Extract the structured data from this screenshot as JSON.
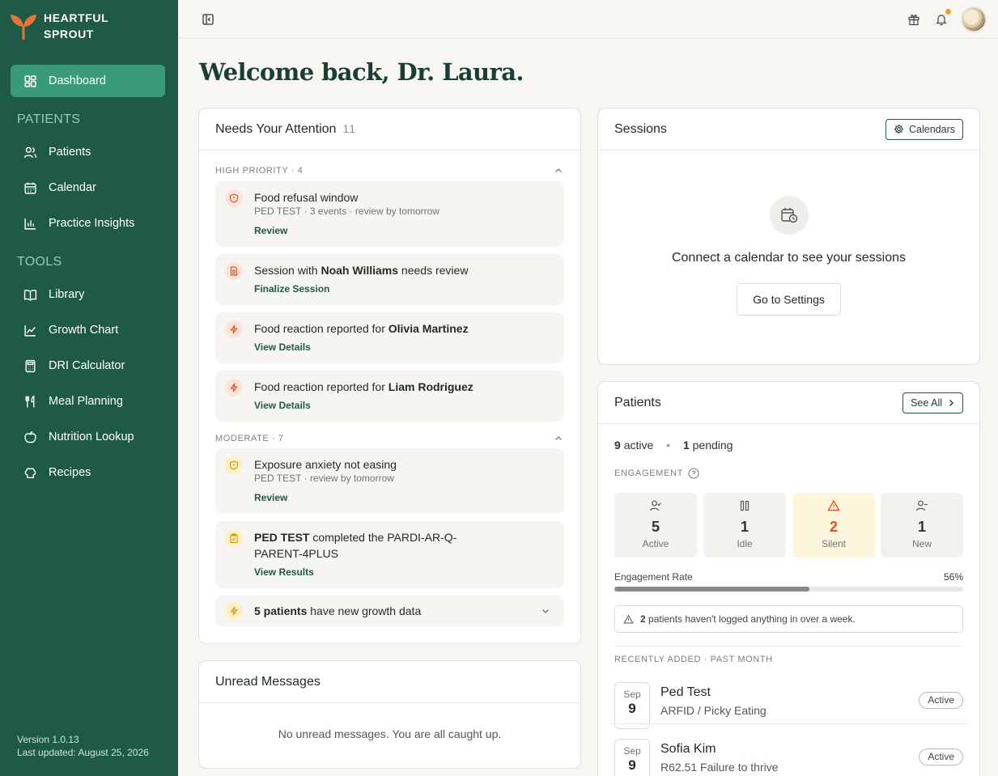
{
  "app": {
    "brand_line1": "HEARTFUL",
    "brand_line2": "SPROUT"
  },
  "sidebar": {
    "dashboard": "Dashboard",
    "patients_section": "PATIENTS",
    "patients_items": [
      "Patients",
      "Calendar",
      "Practice Insights"
    ],
    "tools_section": "TOOLS",
    "tools_items": [
      "Library",
      "Growth Chart",
      "DRI Calculator",
      "Meal Planning",
      "Nutrition Lookup",
      "Recipes"
    ],
    "version": "Version 1.0.13",
    "last_updated": "Last updated: August 25, 2026"
  },
  "header": {
    "welcome": "Welcome back, Dr. Laura."
  },
  "attention": {
    "title": "Needs Your Attention",
    "count": "11",
    "high_label": "HIGH PRIORITY · 4",
    "moderate_label": "MODERATE · 7",
    "items": [
      {
        "title": "Food refusal window",
        "sub": "PED TEST · 3 events · review by tomorrow",
        "link": "Review"
      },
      {
        "pre": "Session with ",
        "bold": "Noah Williams",
        "post": " needs review",
        "link": "Finalize Session"
      },
      {
        "pre": "Food reaction reported for ",
        "bold": "Olivia Martinez",
        "link": "View Details"
      },
      {
        "pre": "Food reaction reported for ",
        "bold": "Liam Rodriguez",
        "link": "View Details"
      },
      {
        "title": "Exposure anxiety not easing",
        "sub": "PED TEST · review by tomorrow",
        "link": "Review"
      },
      {
        "bold": "PED TEST",
        "post": " completed the PARDI-AR-Q-PARENT-4PLUS",
        "link": "View Results"
      },
      {
        "bold": "5 patients",
        "post": " have new growth data"
      }
    ]
  },
  "sessions": {
    "title": "Sessions",
    "calendars_button": "Calendars",
    "empty_text": "Connect a calendar to see your sessions",
    "settings_button": "Go to Settings"
  },
  "messages": {
    "title": "Unread Messages",
    "empty_text": "No unread messages. You are all caught up."
  },
  "patients": {
    "title": "Patients",
    "see_all": "See All",
    "active_count": "9",
    "active_label": "active",
    "pending_count": "1",
    "pending_label": "pending",
    "engagement_label": "ENGAGEMENT",
    "engagement": [
      {
        "value": "5",
        "label": "Active"
      },
      {
        "value": "1",
        "label": "Idle"
      },
      {
        "value": "2",
        "label": "Silent"
      },
      {
        "value": "1",
        "label": "New"
      }
    ],
    "rate_label": "Engagement Rate",
    "rate_value": "56%",
    "rate_fraction": 0.56,
    "warning_count": "2",
    "warning_text": " patients haven't logged anything in over a week.",
    "recent_label": "RECENTLY ADDED · PAST MONTH",
    "recent": [
      {
        "month": "Sep",
        "day": "9",
        "name": "Ped Test",
        "dx": "ARFID / Picky Eating",
        "status": "Active"
      },
      {
        "month": "Sep",
        "day": "9",
        "name": "Sofia Kim",
        "dx": "R62.51 Failure to thrive",
        "status": "Active"
      }
    ]
  },
  "colors": {
    "sidebar": "#1e5a46",
    "accent": "#3a9b78",
    "warning": "#d9541e",
    "danger_soft": "#fbe4dc"
  },
  "icons": [
    "sprout-logo",
    "sidebar-toggle-icon",
    "gift-icon",
    "bell-icon",
    "grid-icon",
    "users-icon",
    "calendar-icon",
    "bar-chart-icon",
    "book-icon",
    "line-chart-icon",
    "calculator-icon",
    "utensils-icon",
    "apple-icon",
    "chef-hat-icon"
  ]
}
